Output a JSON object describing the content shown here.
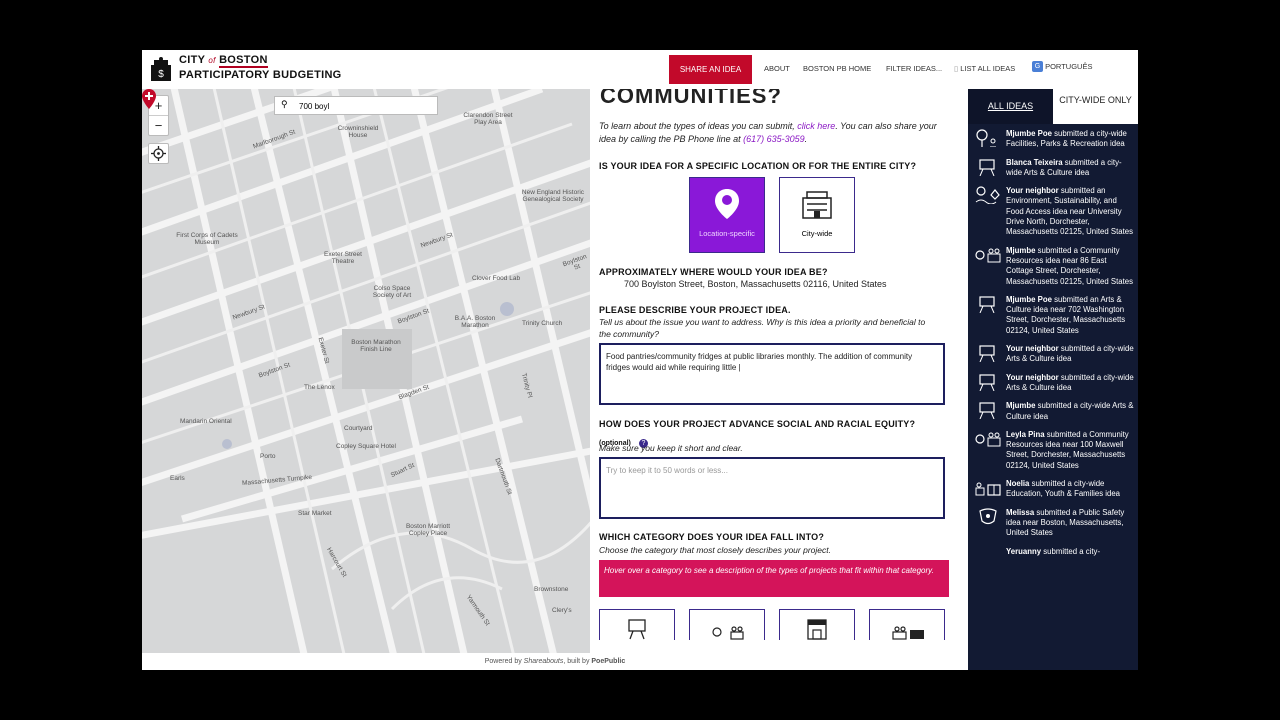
{
  "header": {
    "brand_line1_a": "CITY",
    "brand_line1_of": "of",
    "brand_line1_b": "BOSTON",
    "brand_line2": "PARTICIPATORY BUDGETING",
    "share_label": "SHARE AN IDEA",
    "nav": [
      "ABOUT",
      "BOSTON PB HOME",
      "FILTER IDEAS...",
      "LIST ALL IDEAS",
      "PORTUGUÊS"
    ],
    "brand_color": "#c2092a"
  },
  "map": {
    "search_value": "700 boyl",
    "zoom_in": "+",
    "zoom_out": "−",
    "labels": [
      "Clarendon Street Play Area",
      "Crowninshield House",
      "Marlborough St",
      "New England Historic Genealogical Society",
      "First Corps of Cadets Museum",
      "Exeter Street Theatre",
      "Newbury St",
      "Clover Food Lab",
      "Boylston St",
      "Colso Space Society of Art",
      "Boylston St",
      "B.A.A. Boston Marathon",
      "Trinity Church",
      "Newbury St",
      "Boston Marathon Finish Line",
      "Exeter St",
      "Boylston St",
      "The Lenox",
      "Blagden St",
      "Mandarin Oriental",
      "Courtyard",
      "Copley Square Hotel",
      "Porto",
      "Earls",
      "Massachusetts Turnpike",
      "Stuart St",
      "Star Market",
      "Boston Marriott Copley Place",
      "Dartmouth St",
      "Harcourt St",
      "Brownstone",
      "Yarmouth St",
      "Clery's",
      "Trinity Pl"
    ]
  },
  "form": {
    "intro_a": "To learn about the types of ideas you can submit, ",
    "intro_link": "click here",
    "intro_b": ". You can also share your idea by calling the PB Phone line at ",
    "phone": "(617) 635-3059",
    "intro_c": ".",
    "q_location": "IS YOUR IDEA FOR A SPECIFIC LOCATION OR FOR THE ENTIRE CITY?",
    "choice_location": "Location-specific",
    "choice_citywide": "City-wide",
    "q_where": "APPROXIMATELY WHERE WOULD YOUR IDEA BE?",
    "address": "700 Boylston Street, Boston, Massachusetts 02116, United States",
    "q_describe": "PLEASE DESCRIBE YOUR PROJECT IDEA.",
    "describe_hint": "Tell us about the issue you want to address. Why is this idea a priority and beneficial to the community?",
    "describe_value": "Food pantries/community fridges at public libraries monthly. The addition of community fridges would aid while requiring little |",
    "q_equity": "HOW DOES YOUR PROJECT ADVANCE SOCIAL AND RACIAL EQUITY?",
    "optional": "(optional)",
    "equity_hint": "Make sure you keep it short and clear.",
    "equity_placeholder": "Try to keep it to 50 words or less...",
    "q_category": "WHICH CATEGORY DOES YOUR IDEA FALL INTO?",
    "category_hint": "Choose the category that most closely describes your project.",
    "hover_text": "Hover over a category to see a description of the types of projects that fit within that category.",
    "accent_color": "#8a18d8",
    "hover_color": "#d4145a"
  },
  "sidebar": {
    "tab_all": "ALL IDEAS",
    "tab_city": "CITY-WIDE ONLY",
    "items": [
      {
        "name": "Mjumbe Poe",
        "text": " submitted a city-wide Facilities, Parks & Recreation idea"
      },
      {
        "name": "Blanca Teixeira",
        "text": " submitted a city-wide Arts & Culture idea"
      },
      {
        "name": "Your neighbor",
        "text": " submitted an Environment, Sustainability, and Food Access idea near University Drive North, Dorchester, Massachusetts 02125, United States"
      },
      {
        "name": "Mjumbe",
        "text": " submitted a Community Resources idea near 86 East Cottage Street, Dorchester, Massachusetts 02125, United States"
      },
      {
        "name": "Mjumbe Poe",
        "text": " submitted an Arts & Culture idea near 702 Washington Street, Dorchester, Massachusetts 02124, United States"
      },
      {
        "name": "Your neighbor",
        "text": " submitted a city-wide Arts & Culture idea"
      },
      {
        "name": "Your neighbor",
        "text": " submitted a city-wide Arts & Culture idea"
      },
      {
        "name": "Mjumbe",
        "text": " submitted a city-wide Arts & Culture idea"
      },
      {
        "name": "Leyla Pina",
        "text": " submitted a Community Resources idea near 100 Maxwell Street, Dorchester, Massachusetts 02124, United States"
      },
      {
        "name": "Noelia",
        "text": " submitted a city-wide Education, Youth & Families idea"
      },
      {
        "name": "Melissa",
        "text": " submitted a Public Safety idea near Boston, Massachusetts, United States"
      },
      {
        "name": "Yeruanny",
        "text": " submitted a city-"
      }
    ]
  },
  "footer": {
    "powered_a": "Powered by ",
    "powered_brand": "Shareabouts",
    "powered_b": ", built by ",
    "powered_c": "PoePublic"
  }
}
